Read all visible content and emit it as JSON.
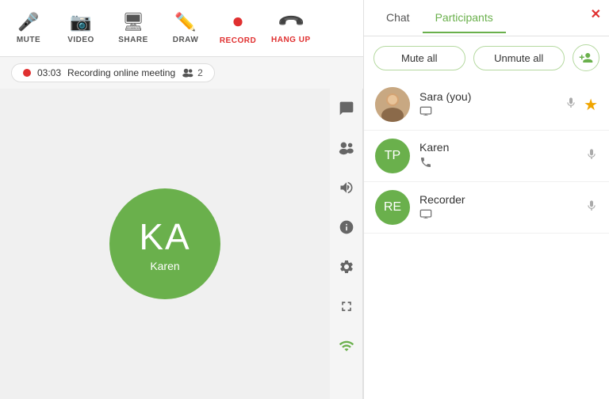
{
  "toolbar": {
    "items": [
      {
        "id": "mute",
        "label": "MUTE",
        "icon": "🎤"
      },
      {
        "id": "video",
        "label": "VIDEO",
        "icon": "📷"
      },
      {
        "id": "share",
        "label": "SHARE",
        "icon": "🖥"
      },
      {
        "id": "draw",
        "label": "DRAW",
        "icon": "✏️"
      },
      {
        "id": "record",
        "label": "RECORD",
        "icon": "⏺",
        "special": "record"
      },
      {
        "id": "hangup",
        "label": "HANG UP",
        "icon": "📞",
        "special": "hangup"
      }
    ]
  },
  "recording": {
    "timer": "03:03",
    "label": "Recording online meeting",
    "people_count": "2"
  },
  "main_avatar": {
    "initials": "KA",
    "name": "Karen",
    "bg_color": "#6ab04c"
  },
  "sidebar_icons": [
    {
      "id": "chat",
      "icon": "💬"
    },
    {
      "id": "participants",
      "icon": "👥"
    },
    {
      "id": "megaphone",
      "icon": "📢"
    },
    {
      "id": "info",
      "icon": "ℹ"
    },
    {
      "id": "settings",
      "icon": "⚙"
    },
    {
      "id": "fullscreen",
      "icon": "⛶"
    },
    {
      "id": "wifi",
      "icon": "📶"
    }
  ],
  "right_panel": {
    "tabs": [
      {
        "id": "chat",
        "label": "Chat",
        "active": false
      },
      {
        "id": "participants",
        "label": "Participants",
        "active": true
      }
    ],
    "close_label": "✕",
    "actions": {
      "mute_all": "Mute all",
      "unmute_all": "Unmute all",
      "add_icon": "+"
    },
    "participants": [
      {
        "id": "sara",
        "name": "Sara (you)",
        "type": "photo",
        "status_icon": "🖥",
        "has_mic": true,
        "has_star": true
      },
      {
        "id": "karen",
        "name": "Karen",
        "initials": "TP",
        "bg": "#6ab04c",
        "status_icon": "📞",
        "has_mic": true,
        "has_star": false
      },
      {
        "id": "recorder",
        "name": "Recorder",
        "initials": "RE",
        "bg": "#6ab04c",
        "status_icon": "🖥",
        "has_mic": true,
        "has_star": false
      }
    ]
  }
}
